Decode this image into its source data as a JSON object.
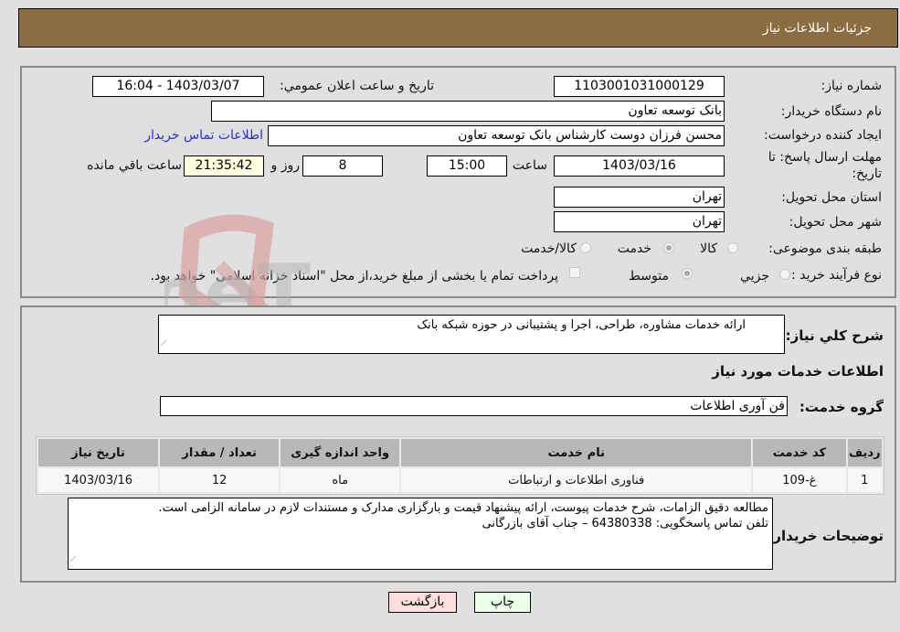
{
  "header": {
    "title": "جزئیات اطلاعات نیاز"
  },
  "details": {
    "need_number_label": "شماره نیاز:",
    "need_number": "1103001031000129",
    "announce_label": "تاریخ و ساعت اعلان عمومي:",
    "announce_value": "1403/03/07 - 16:04",
    "buyer_org_label": "نام دستگاه خریدار:",
    "buyer_org": "بانک توسعه تعاون",
    "requester_label": "ایجاد کننده درخواست:",
    "requester": "محسن فرزان دوست کارشناس بانک توسعه تعاون",
    "buyer_contact_link": "اطلاعات تماس خریدار",
    "deadline_label_line1": "مهلت ارسال پاسخ: تا",
    "deadline_label_line2": "تاریخ:",
    "deadline_date": "1403/03/16",
    "time_label": "ساعت",
    "deadline_time": "15:00",
    "days_value": "8",
    "days_label": "روز و",
    "remaining_time": "21:35:42",
    "remaining_label": "ساعت باقي مانده",
    "province_label": "استان محل تحویل:",
    "province": "تهران",
    "city_label": "شهر محل تحویل:",
    "city": "تهران",
    "category_label": "طبقه بندی موضوعی:",
    "category_options": [
      {
        "label": "کالا",
        "selected": false
      },
      {
        "label": "خدمت",
        "selected": true
      },
      {
        "label": "کالا/خدمت",
        "selected": false
      }
    ],
    "process_label": "نوع فرآیند خرید :",
    "process_options": [
      {
        "label": "جزيي",
        "selected": false
      },
      {
        "label": "متوسط",
        "selected": true
      }
    ],
    "treasury_checkbox_label": "پرداخت تمام یا بخشی از مبلغ خرید،از محل \"اسناد خزانه اسلامی\" خواهد بود.",
    "treasury_checked": false
  },
  "description": {
    "general_label": "شرح کلي نیاز:",
    "general_text": "ارائه خدمات مشاوره، طراحی، اجرا و پشتیبانی در حوزه شبکه بانک",
    "services_heading": "اطلاعات خدمات مورد نیاز",
    "service_group_label": "گروه خدمت:",
    "service_group": "فن آوری اطلاعات"
  },
  "table": {
    "headers": [
      "ردیف",
      "کد خدمت",
      "نام خدمت",
      "واحد اندازه گیری",
      "تعداد / مقدار",
      "تاریخ نیاز"
    ],
    "rows": [
      [
        "1",
        "غ-109",
        "فناوری اطلاعات و ارتباطات",
        "ماه",
        "12",
        "1403/03/16"
      ]
    ]
  },
  "buyer_notes": {
    "label": "توضیحات خریدار:",
    "line1": "مطالعه دقیق الزامات، شرح خدمات پیوست، ارائه پیشنهاد قیمت و بارگزاری مدارک و مستندات لازم در سامانه الزامی است.",
    "line2": "تلفن تماس پاسخگویی: 64380338 – جناب آقای بازرگانی"
  },
  "buttons": {
    "print": "چاپ",
    "back": "بازگشت"
  },
  "watermark": {
    "text": "AriaTender.neT"
  },
  "colors": {
    "header_bg": "#8c6d42",
    "link": "#2a2ae0",
    "print_bg": "#eaffea",
    "back_bg": "#ffdede",
    "remaining_bg": "#ffffe0"
  }
}
